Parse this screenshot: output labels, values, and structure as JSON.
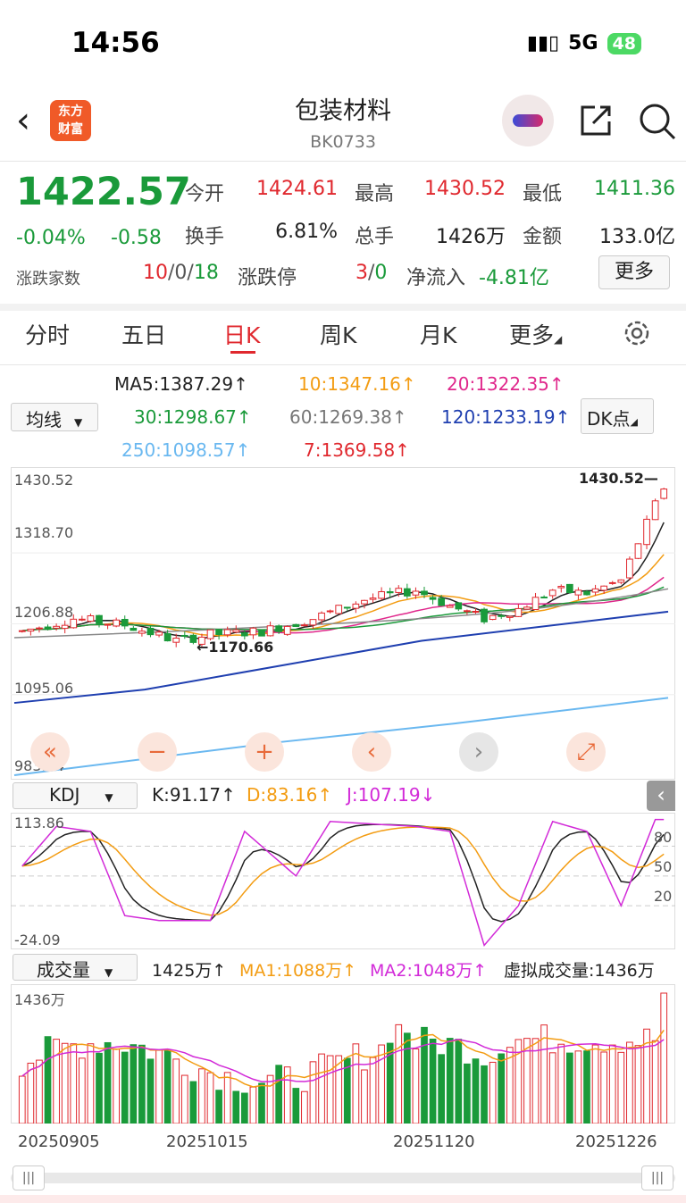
{
  "status": {
    "time": "14:56",
    "network": "5G",
    "battery": "48"
  },
  "nav": {
    "title": "包装材料",
    "code": "BK0733",
    "logo_line1": "东方",
    "logo_line2": "财富"
  },
  "quote": {
    "price": "1422.57",
    "change_pct": "-0.04%",
    "change": "-0.58",
    "open_label": "今开",
    "open": "1424.61",
    "high_label": "最高",
    "high": "1430.52",
    "low_label": "最低",
    "low": "1411.36",
    "turnover_label": "换手",
    "turnover": "6.81%",
    "volume_label": "总手",
    "volume": "1426万",
    "amount_label": "金额",
    "amount": "133.0亿",
    "breadth_label": "涨跌家数",
    "breadth_up": "10",
    "breadth_flat": "0",
    "breadth_down": "18",
    "limit_label": "涨跌停",
    "limit_up": "3",
    "limit_down": "0",
    "inflow_label": "净流入",
    "inflow": "-4.81亿",
    "more_label": "更多"
  },
  "tabs": [
    "分时",
    "五日",
    "日K",
    "周K",
    "月K",
    "更多"
  ],
  "ma": {
    "selector": "均线",
    "ma5": "MA5:1387.29↑",
    "ma10": "10:1347.16↑",
    "ma20": "20:1322.35↑",
    "ma30": "30:1298.67↑",
    "ma60": "60:1269.38↑",
    "ma120": "120:1233.19↑",
    "ma250": "250:1098.57↑",
    "ma7": "7:1369.58↑",
    "dk_label": "DK点"
  },
  "kchart": {
    "y_labels": [
      "1430.52",
      "1318.70",
      "1206.88",
      "1095.06",
      "983.24"
    ],
    "high_marker": "1430.52",
    "low_marker": "←1170.66"
  },
  "kdj": {
    "selector": "KDJ",
    "k": "K:91.17↑",
    "d": "D:83.16↑",
    "j": "J:107.19↓",
    "y_top": "113.86",
    "y_bottom": "-24.09",
    "levels": [
      "80",
      "50",
      "20"
    ]
  },
  "vol": {
    "selector": "成交量",
    "current": "1425万↑",
    "ma1": "MA1:1088万↑",
    "ma2": "MA2:1048万↑",
    "virtual": "虚拟成交量:1436万",
    "y_top": "1436万"
  },
  "dates": [
    "20250905",
    "20251015",
    "20251120",
    "20251226"
  ],
  "colors": {
    "up": "#e0282e",
    "down": "#1a9a3a",
    "ma5": "#222222",
    "ma10": "#f39c12",
    "ma20": "#e0288c",
    "ma30": "#1a9a3a",
    "ma60": "#888888",
    "ma120": "#1f3fb0",
    "ma250": "#6ab8f0",
    "ma7": "#e0282e"
  }
}
